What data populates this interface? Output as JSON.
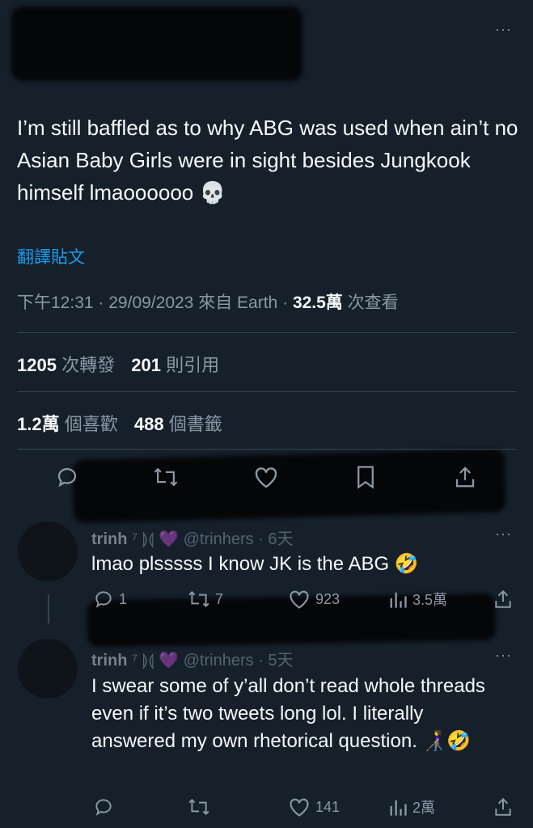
{
  "tweet": {
    "text": "I’m still baffled as to why ABG was used when ain’t no Asian Baby Girls were in sight besides Jungkook himself lmaoooooo 💀",
    "translate_label": "翻譯貼文",
    "time": "下午12:31",
    "date": "29/09/2023",
    "source_prefix": "來自",
    "source": "Earth",
    "views_count": "32.5萬",
    "views_label": "次查看",
    "sep": "·"
  },
  "stats": {
    "retweets_count": "1205",
    "retweets_label": "次轉發",
    "quotes_count": "201",
    "quotes_label": "則引用",
    "likes_count": "1.2萬",
    "likes_label": "個喜歡",
    "bookmarks_count": "488",
    "bookmarks_label": "個書籤"
  },
  "more_glyph": "···",
  "replies": [
    {
      "name": "trinh",
      "name_suffix": "⁷ ⟭⟬ 💜",
      "handle": "@trinhers",
      "age": "6天",
      "text": "lmao plsssss I know JK is the ABG 🤣",
      "reply_count": "1",
      "retweet_count": "7",
      "like_count": "923",
      "view_count": "3.5萬"
    },
    {
      "name": "trinh",
      "name_suffix": "⁷ ⟭⟬ 💜",
      "handle": "@trinhers",
      "age": "5天",
      "text": "I swear some of y’all don’t read whole threads even if it’s two tweets long lol. I literally answered my own rhetorical question. 👩‍🦯🤣",
      "reply_count": "",
      "retweet_count": "",
      "like_count": "141",
      "view_count": "2萬"
    }
  ],
  "colors": {
    "background": "#15202b",
    "text": "#f7f9f9",
    "muted": "#8b98a5",
    "link": "#1d9bf0",
    "divider": "#38444d"
  }
}
